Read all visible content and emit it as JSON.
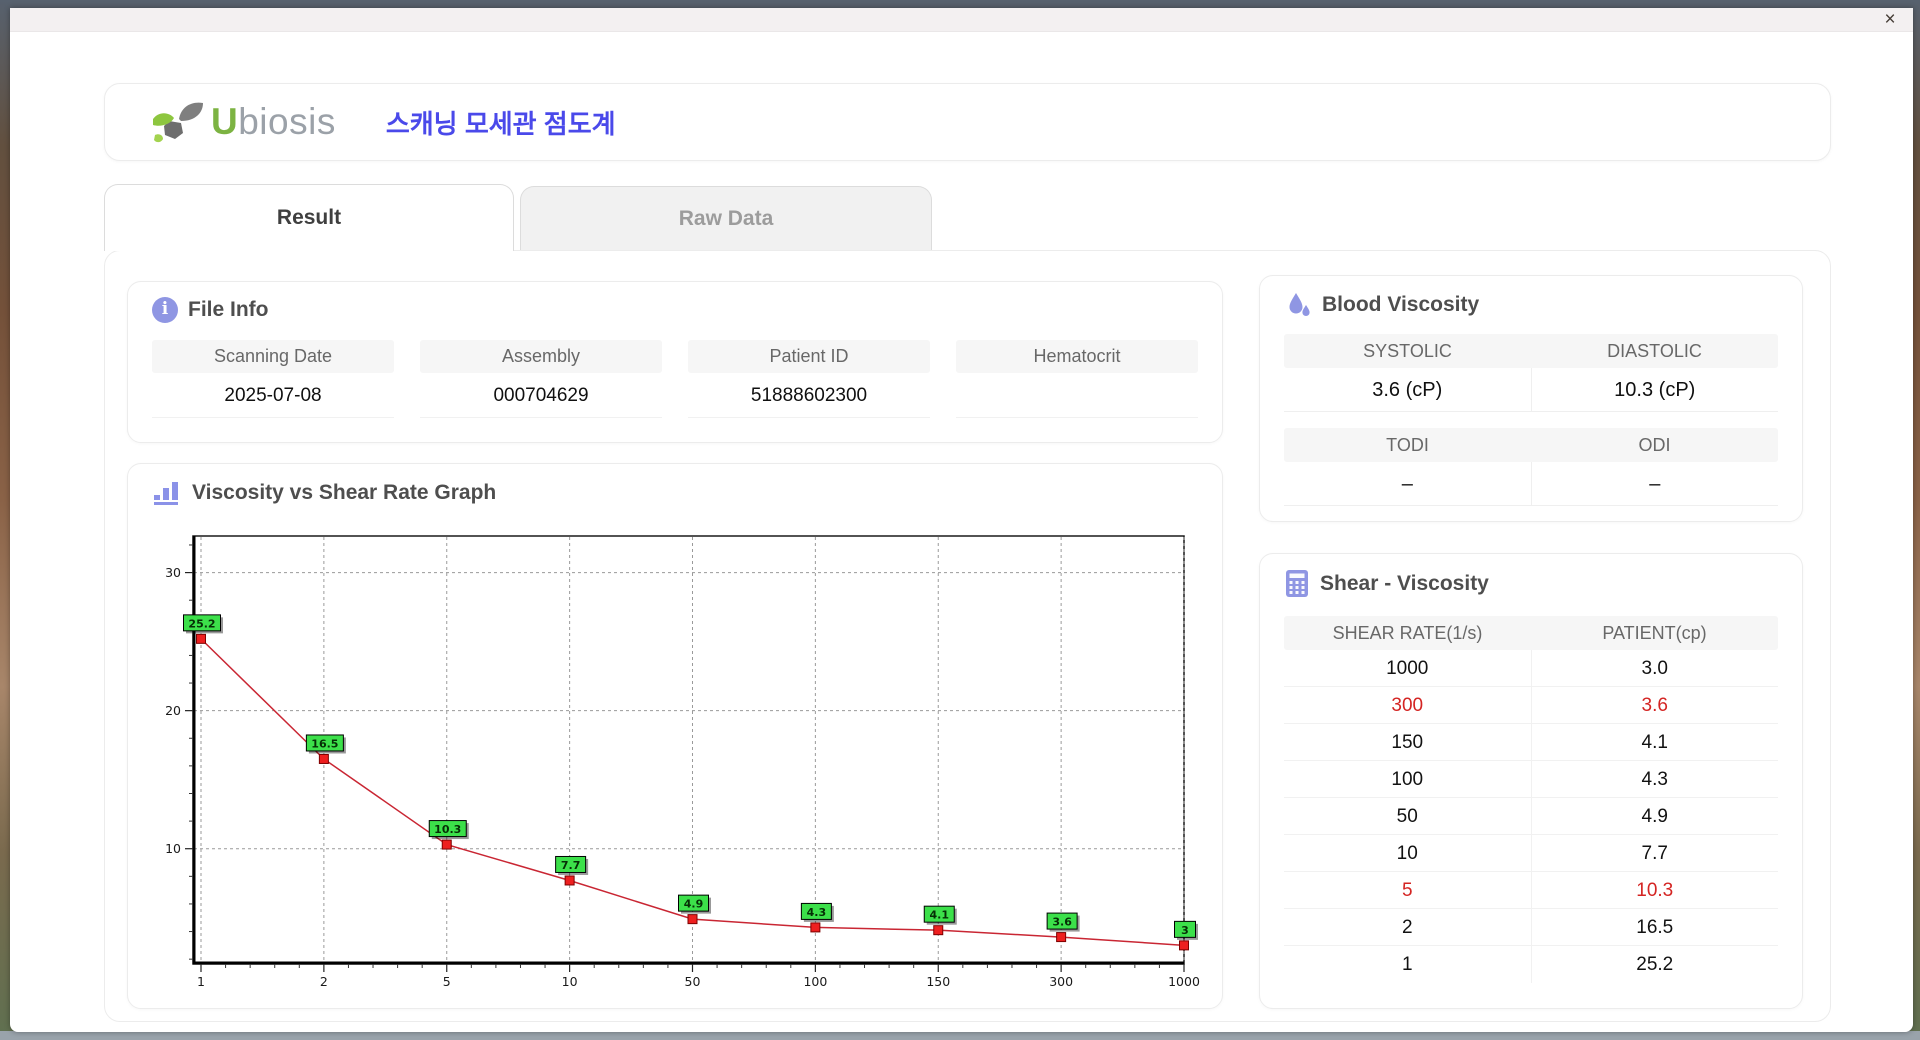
{
  "window": {
    "close_glyph": "×"
  },
  "header": {
    "logo_u": "U",
    "logo_rest": "biosis",
    "app_title": "스캐닝 모세관 점도계"
  },
  "tabs": [
    {
      "label": "Result",
      "active": true
    },
    {
      "label": "Raw Data",
      "active": false
    }
  ],
  "file_info": {
    "title": "File Info",
    "fields": [
      {
        "label": "Scanning Date",
        "value": "2025-07-08"
      },
      {
        "label": "Assembly",
        "value": "000704629"
      },
      {
        "label": "Patient ID",
        "value": "51888602300"
      },
      {
        "label": "Hematocrit",
        "value": ""
      }
    ]
  },
  "blood_viscosity": {
    "title": "Blood Viscosity",
    "row1": {
      "h1": "SYSTOLIC",
      "h2": "DIASTOLIC",
      "v1": "3.6 (cP)",
      "v2": "10.3 (cP)"
    },
    "row2": {
      "h1": "TODI",
      "h2": "ODI",
      "v1": "–",
      "v2": "–"
    }
  },
  "shear_viscosity": {
    "title": "Shear - Viscosity",
    "columns": [
      "SHEAR RATE(1/s)",
      "PATIENT(cp)"
    ],
    "rows": [
      {
        "shear_rate": "1000",
        "patient": "3.0",
        "highlight": false
      },
      {
        "shear_rate": "300",
        "patient": "3.6",
        "highlight": true
      },
      {
        "shear_rate": "150",
        "patient": "4.1",
        "highlight": false
      },
      {
        "shear_rate": "100",
        "patient": "4.3",
        "highlight": false
      },
      {
        "shear_rate": "50",
        "patient": "4.9",
        "highlight": false
      },
      {
        "shear_rate": "10",
        "patient": "7.7",
        "highlight": false
      },
      {
        "shear_rate": "5",
        "patient": "10.3",
        "highlight": true
      },
      {
        "shear_rate": "2",
        "patient": "16.5",
        "highlight": false
      },
      {
        "shear_rate": "1",
        "patient": "25.2",
        "highlight": false
      }
    ]
  },
  "graph": {
    "title": "Viscosity vs Shear Rate Graph"
  },
  "chart_data": {
    "type": "line",
    "title": "Viscosity vs Shear Rate Graph",
    "x": [
      1,
      2,
      5,
      10,
      50,
      100,
      150,
      300,
      1000
    ],
    "x_ticks": [
      "1",
      "2",
      "5",
      "10",
      "50",
      "100",
      "150",
      "300",
      "1000"
    ],
    "values": [
      25.2,
      16.5,
      10.3,
      7.7,
      4.9,
      4.3,
      4.1,
      3.6,
      3.0
    ],
    "point_labels": [
      "25.2",
      "16.5",
      "10.3",
      "7.7",
      "4.9",
      "4.3",
      "4.1",
      "3.6",
      "3"
    ],
    "y_ticks": [
      10,
      20,
      30
    ],
    "ylim": [
      1.65,
      32.65
    ],
    "xlabel": "",
    "ylabel": "",
    "x_axis": "categorical equal spacing",
    "grid": "dashed",
    "legend": "none",
    "line_color": "#c92633",
    "marker_color": "#ee1f1f",
    "marker_border": "#7d0000",
    "label_bg": "#3ce04a",
    "label_border": "#000000"
  },
  "colors": {
    "accent_purple": "#8f96e3",
    "app_title_blue": "#4a49ea",
    "logo_green": "#7cb342",
    "logo_gray": "#9ba1a8",
    "highlight_red": "#d42422",
    "table_header_bg": "#f6f6f6"
  }
}
